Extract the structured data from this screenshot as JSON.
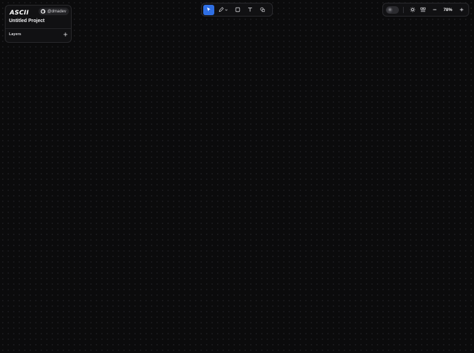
{
  "project_panel": {
    "logo_text": "ASCII",
    "github_handle": "@dmadev",
    "project_title": "Untitled Project",
    "layers_label": "Layers"
  },
  "toolbar": {
    "tools": [
      {
        "name": "select",
        "icon": "cursor-icon",
        "active": true
      },
      {
        "name": "pen",
        "icon": "pen-icon",
        "has_dropdown": true
      },
      {
        "name": "rectangle",
        "icon": "rectangle-icon"
      },
      {
        "name": "text",
        "icon": "text-icon"
      },
      {
        "name": "shapes",
        "icon": "shapes-icon"
      }
    ]
  },
  "controls": {
    "theme_toggle_icon": "sun-icon",
    "brightness_icon": "brightness-icon",
    "grid_icon": "grid-icon",
    "zoom_level": "78%"
  },
  "colors": {
    "background": "#0b0b0c",
    "panel": "#111113",
    "accent": "#2f6fe4"
  }
}
